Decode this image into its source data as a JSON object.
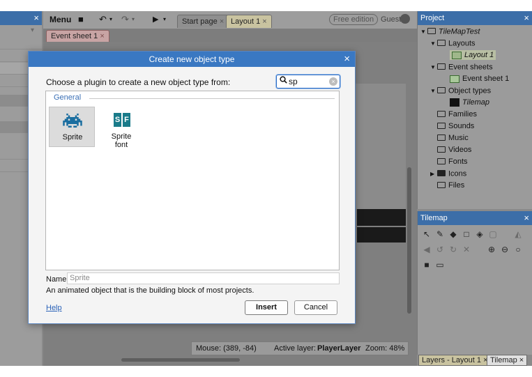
{
  "toolbar": {
    "menu_label": "Menu",
    "save_glyph": "■",
    "undo_glyph": "↶",
    "redo_glyph": "↷",
    "play_glyph": "▶",
    "dropdown_glyph": "▾",
    "tabs": [
      {
        "label": "Start page",
        "close": "×"
      },
      {
        "label": "Layout 1",
        "close": "×"
      }
    ],
    "edition_badge": "Free edition",
    "user_label": "Guest"
  },
  "subtab": {
    "label": "Event sheet 1",
    "close": "×"
  },
  "left_panel": {
    "close": "×",
    "collapse": "▾"
  },
  "status_bar": {
    "mouse": "Mouse: (389, -84)",
    "active_layer_label": "Active layer:",
    "active_layer_value": "PlayerLayer",
    "zoom": "Zoom: 48%"
  },
  "project_panel": {
    "title": "Project",
    "close": "×",
    "tree": [
      {
        "label": "TileMapTest"
      },
      {
        "label": "Layouts"
      },
      {
        "label": "Layout 1"
      },
      {
        "label": "Event sheets"
      },
      {
        "label": "Event sheet 1"
      },
      {
        "label": "Object types"
      },
      {
        "label": "Tilemap"
      },
      {
        "label": "Families"
      },
      {
        "label": "Sounds"
      },
      {
        "label": "Music"
      },
      {
        "label": "Videos"
      },
      {
        "label": "Fonts"
      },
      {
        "label": "Icons"
      },
      {
        "label": "Files"
      }
    ]
  },
  "tilemap_panel": {
    "title": "Tilemap",
    "close": "×"
  },
  "bottom_tabs": [
    {
      "label": "Layers - Layout 1",
      "close": "×"
    },
    {
      "label": "Tilemap",
      "close": "×"
    }
  ],
  "dialog": {
    "title": "Create new object type",
    "close": "×",
    "prompt": "Choose a plugin to create a new object type from:",
    "search_icon": "🔍",
    "search_value": "sp",
    "search_clear": "×",
    "group_label": "General",
    "plugins": [
      {
        "label": "Sprite"
      },
      {
        "label": "Sprite font",
        "glyph_left": "S",
        "glyph_right": "F"
      }
    ],
    "name_label": "Name",
    "name_value": "Sprite",
    "description": "An animated object that is the building block of most projects.",
    "help_label": "Help",
    "insert_label": "Insert",
    "cancel_label": "Cancel"
  },
  "colors": {
    "dialog_title_bar": "#3a78c2",
    "panel_header": "#3c6ea8",
    "sprite_icon": "#1b6ea0",
    "sprite_font_icon": "#1a7b8a",
    "help_link": "#2a62b8"
  },
  "icons": {
    "sprite": "space-invader-icon",
    "sprite_font": "sprite-font-icon",
    "tilemap_tools": [
      "cursor-icon",
      "pencil-icon",
      "eraser-icon",
      "rectangle-icon",
      "fill-bucket-icon",
      "square-outline-icon",
      "flip-horizontal-icon",
      "flip-vertical-icon",
      "rotate-ccw-icon",
      "rotate-cw-icon",
      "clear-icon",
      "zoom-in-icon",
      "zoom-out-icon",
      "zoom-icon",
      "save-icon",
      "folder-icon"
    ]
  }
}
